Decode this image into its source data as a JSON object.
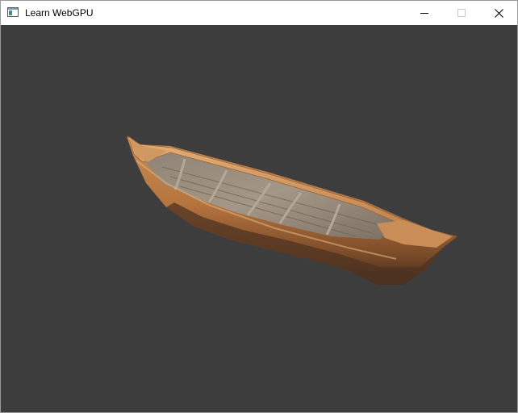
{
  "window": {
    "title": "Learn WebGPU",
    "app_icon": "window-app-icon",
    "controls": {
      "minimize_icon": "minimize-icon",
      "maximize_icon": "maximize-icon",
      "close_icon": "close-icon"
    }
  },
  "viewport": {
    "background": "#3d3d3d",
    "object": "wooden-rowboat"
  }
}
